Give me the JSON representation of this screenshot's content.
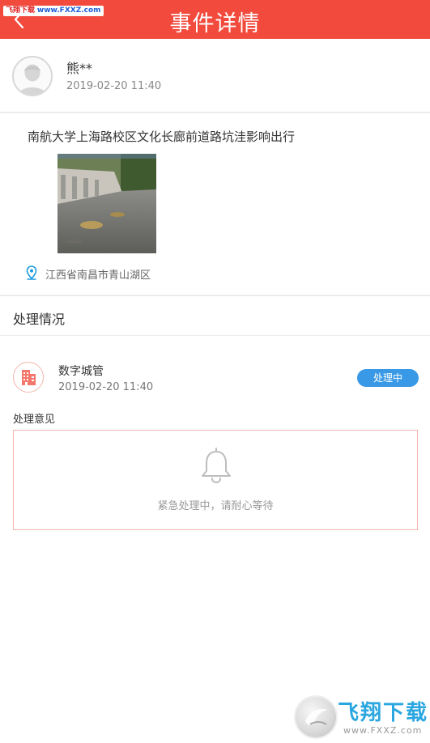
{
  "header": {
    "title": "事件详情",
    "back_icon": "chevron-left-icon"
  },
  "watermark_top": {
    "part1": "飞翔下载",
    "part2": "www.FXXZ.com"
  },
  "reporter": {
    "name": "熊**",
    "time": "2019-02-20 11:40",
    "avatar_icon": "user-avatar-icon"
  },
  "event": {
    "description": "南航大学上海路校区文化长廊前道路坑洼影响出行",
    "location": "江西省南昌市青山湖区",
    "location_icon": "map-pin-icon"
  },
  "processing": {
    "section_title": "处理情况",
    "org_name": "数字城管",
    "org_time": "2019-02-20 11:40",
    "status": "处理中",
    "opinion_label": "处理意见",
    "opinion_message": "紧急处理中，请耐心等待",
    "org_icon": "building-icon",
    "empty_icon": "bell-icon"
  },
  "watermark_bottom": {
    "brand": "飞翔下载",
    "url": "www.FXXZ.com"
  },
  "colors": {
    "header": "#f24a3c",
    "badge": "#3a99e6",
    "accent_pink": "#f3b5ae",
    "pin": "#1a9be0"
  }
}
